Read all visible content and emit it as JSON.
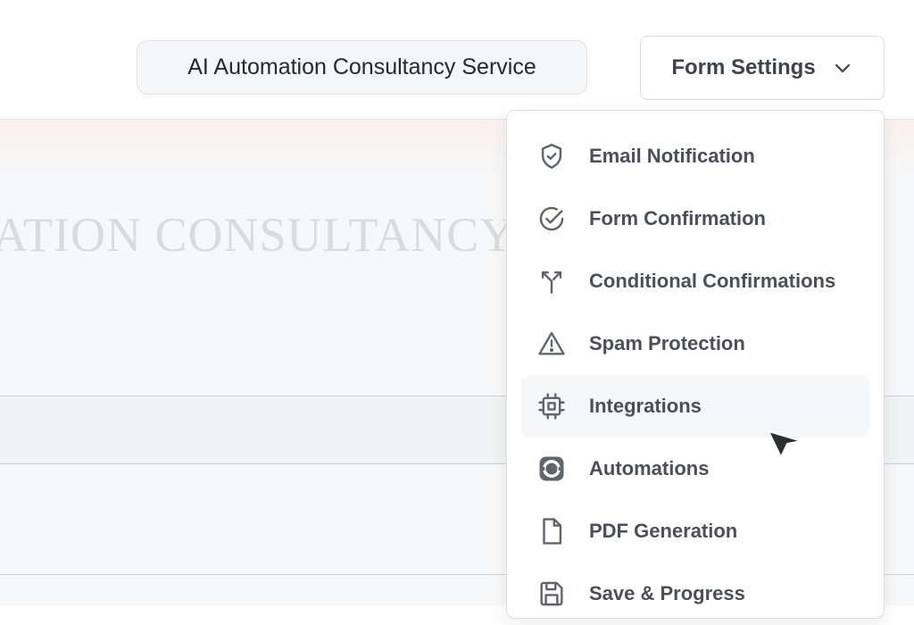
{
  "form_title": "AI Automation Consultancy Service",
  "form_settings": {
    "label": "Form Settings",
    "chevron_icon": "chevron-down-icon"
  },
  "canvas": {
    "hero_text": "ATION CONSULTANCY S"
  },
  "menu": {
    "items": [
      {
        "label": "Email Notification",
        "icon": "shield-check-icon"
      },
      {
        "label": "Form Confirmation",
        "icon": "circle-check-icon"
      },
      {
        "label": "Conditional Confirmations",
        "icon": "split-arrows-icon"
      },
      {
        "label": "Spam Protection",
        "icon": "warning-triangle-icon"
      },
      {
        "label": "Integrations",
        "icon": "chip-icon"
      },
      {
        "label": "Automations",
        "icon": "automation-ring-icon"
      },
      {
        "label": "PDF Generation",
        "icon": "document-icon"
      },
      {
        "label": "Save & Progress",
        "icon": "save-icon"
      }
    ]
  },
  "colors": {
    "text_dark": "#25292f",
    "menu_text": "#4a5059",
    "icon_gray": "#5f656d",
    "border": "#dcdfe3"
  }
}
